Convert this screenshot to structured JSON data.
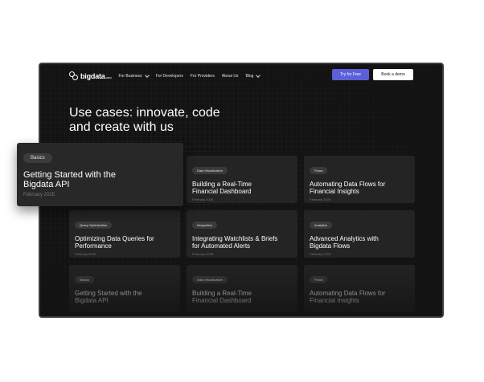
{
  "nav": {
    "logo_text": "bigdata",
    "logo_suffix": ".com",
    "items": [
      {
        "label": "For Business"
      },
      {
        "label": "For Developers"
      },
      {
        "label": "For Providers"
      },
      {
        "label": "About Us"
      },
      {
        "label": "Blog"
      }
    ],
    "try_label": "Try for Free",
    "demo_label": "Book a demo"
  },
  "hero": {
    "line1": "Use cases: innovate, code",
    "line2": "and create with us"
  },
  "featured": {
    "tag": "Basics",
    "title_line1": "Getting Started with the",
    "title_line2": "Bigdata API",
    "date": "February 2025"
  },
  "cards": [
    {
      "tag": "Data Visualization",
      "title_line1": "Building a Real-Time",
      "title_line2": "Financial Dashboard",
      "date": "February 2025"
    },
    {
      "tag": "Flows",
      "title_line1": "Automating Data Flows for",
      "title_line2": "Financial Insights",
      "date": "February 2025"
    },
    {
      "tag": "Query Optimization",
      "title_line1": "Optimizing Data Queries for",
      "title_line2": "Performance",
      "date": "February 2025"
    },
    {
      "tag": "Integration",
      "title_line1": "Integrating Watchlists & Briefs",
      "title_line2": "for Automated Alerts",
      "date": "February 2025"
    },
    {
      "tag": "Analytics",
      "title_line1": "Advanced Analytics with",
      "title_line2": "Bigdata Flows",
      "date": "February 2025"
    },
    {
      "tag": "Basics",
      "title_line1": "Getting Started with the",
      "title_line2": "Bigdata API",
      "date": ""
    },
    {
      "tag": "Data Visualization",
      "title_line1": "Building a Real-Time",
      "title_line2": "Financial Dashboard",
      "date": ""
    },
    {
      "tag": "Flows",
      "title_line1": "Automating Data Flows for",
      "title_line2": "Financial Insights",
      "date": ""
    }
  ],
  "colors": {
    "background": "#131313",
    "card": "#242424",
    "accent": "#5d5fd9"
  }
}
